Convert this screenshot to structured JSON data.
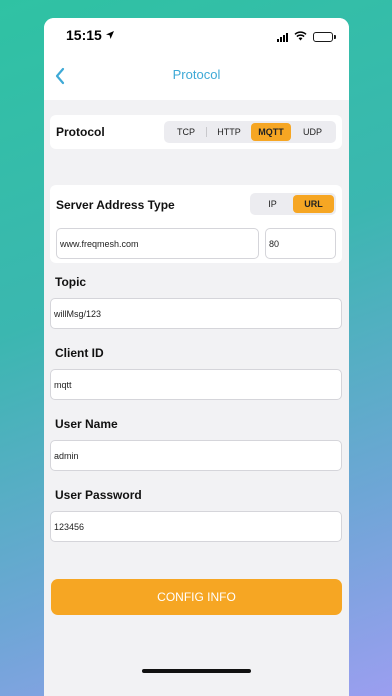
{
  "status_bar": {
    "time": "15:15"
  },
  "nav": {
    "title": "Protocol"
  },
  "protocol_row": {
    "label": "Protocol",
    "options": [
      "TCP",
      "HTTP",
      "MQTT",
      "UDP"
    ],
    "selected": "MQTT"
  },
  "server_address": {
    "label": "Server Address Type",
    "type_options": [
      "IP",
      "URL"
    ],
    "selected_type": "URL",
    "host": "www.freqmesh.com",
    "port": "80"
  },
  "topic": {
    "label": "Topic",
    "value": "willMsg/123"
  },
  "client_id": {
    "label": "Client ID",
    "value": "mqtt"
  },
  "user_name": {
    "label": "User Name",
    "value": "admin"
  },
  "user_password": {
    "label": "User Password",
    "value": "123456"
  },
  "config_button": {
    "label": "CONFIG INFO"
  },
  "colors": {
    "accent": "#f6a623",
    "title": "#3ea9d6"
  }
}
